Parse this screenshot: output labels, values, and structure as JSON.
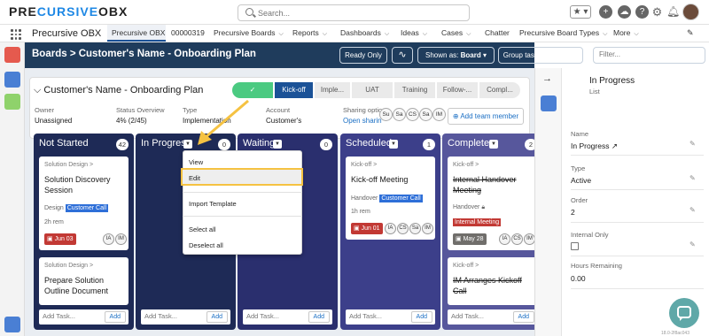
{
  "topbar": {
    "logo_part1": "PRE",
    "logo_part2": "CURSIVE",
    "logo_part3": "OBX",
    "search_placeholder": "Search..."
  },
  "nav": {
    "app_name": "Precursive OBX",
    "tabs": [
      {
        "label": "Precursive OBX",
        "active": true,
        "dropdown": false
      },
      {
        "label": "00000319",
        "active": false,
        "dropdown": false
      },
      {
        "label": "Precursive Boards",
        "active": false,
        "dropdown": true
      },
      {
        "label": "Reports",
        "active": false,
        "dropdown": true
      },
      {
        "label": "Dashboards",
        "active": false,
        "dropdown": true
      },
      {
        "label": "Ideas",
        "active": false,
        "dropdown": true
      },
      {
        "label": "Cases",
        "active": false,
        "dropdown": true
      },
      {
        "label": "Chatter",
        "active": false,
        "dropdown": false
      },
      {
        "label": "Precursive Board Types",
        "active": false,
        "dropdown": true
      },
      {
        "label": "More",
        "active": false,
        "dropdown": true
      }
    ]
  },
  "header": {
    "title": "Boards > Customer's Name - Onboarding Plan",
    "ready_only": "Ready Only",
    "shown_as_prefix": "Shown as:",
    "shown_as_value": "Board",
    "group_by_prefix": "Group tasks by:",
    "group_by_value": "None",
    "filter_placeholder": "Filter..."
  },
  "project": {
    "title": "Customer's Name - Onboarding Plan",
    "stages": [
      "✓",
      "Kick-off",
      "Imple...",
      "UAT",
      "Training",
      "Follow-...",
      "Compl..."
    ],
    "owner_label": "Owner",
    "owner_value": "Unassigned",
    "status_label": "Status Overview",
    "status_value": "4% (2/45)",
    "type_label": "Type",
    "type_value": "Implementation",
    "account_label": "Account",
    "account_value": "Customer's",
    "sharing_label": "Sharing optio",
    "sharing_value": "Open sharin",
    "team_initials": [
      "Su",
      "Sa",
      "CS",
      "Sa",
      "IM"
    ],
    "add_team_member": "Add team member"
  },
  "columns": [
    {
      "name": "Not Started",
      "count": "42",
      "color": "#1e2a56"
    },
    {
      "name": "In Progress",
      "count": "0",
      "color": "#1e2a56"
    },
    {
      "name": "Waiting",
      "count": "0",
      "color": "#2a2f6e"
    },
    {
      "name": "Scheduled",
      "count": "1",
      "color": "#3c3f8a"
    },
    {
      "name": "Complete",
      "count": "2",
      "color": "#57579c"
    }
  ],
  "cards": {
    "c1": {
      "crumb": "Solution Design >",
      "title": "Solution Discovery Session",
      "tag_label": "Design",
      "tag": "Customer Call",
      "rem": "2h rem",
      "date": "Jun 03",
      "chips": [
        "IA",
        "IM"
      ]
    },
    "c2": {
      "crumb": "Solution Design >",
      "title": "Prepare Solution Outline Document"
    },
    "c3": {
      "crumb": "Kick-off >",
      "title": "Kick-off Meeting",
      "tag_label": "Handover",
      "tag": "Customer Call",
      "rem": "1h rem",
      "date": "Jun 01",
      "chips": [
        "IA",
        "CS",
        "Sa",
        "IM"
      ]
    },
    "c4": {
      "crumb": "Kick-off >",
      "title": "Internal Handover Meeting",
      "tag_label": "Handover",
      "tag": "Internal Meeting",
      "date": "May 28",
      "chips": [
        "IA",
        "CS",
        "IM"
      ]
    },
    "c5": {
      "crumb": "Kick-off >",
      "title": "IM Arranges Kickoff Call"
    }
  },
  "add_task": {
    "placeholder": "Add Task...",
    "button": "Add"
  },
  "menu": [
    "View",
    "Edit",
    "Import Template",
    "Select all",
    "Deselect all"
  ],
  "right_panel": {
    "title": "In Progress",
    "subtitle": "List",
    "fields": [
      {
        "label": "Name",
        "value": "In Progress"
      },
      {
        "label": "Type",
        "value": "Active"
      },
      {
        "label": "Order",
        "value": "2"
      },
      {
        "label": "Internal Only",
        "value": ""
      },
      {
        "label": "Hours Remaining",
        "value": "0.00"
      }
    ]
  },
  "version": "18.0-2f8ac043"
}
